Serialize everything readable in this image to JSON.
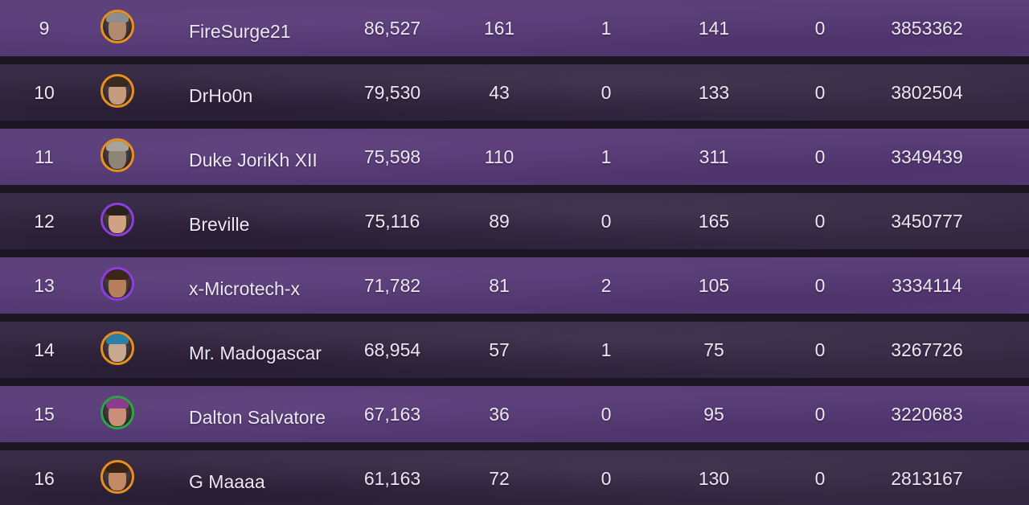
{
  "leaderboard": {
    "rows": [
      {
        "rank": "9",
        "name": "FireSurge21",
        "score": "86,527",
        "stat_a": "161",
        "stat_b": "1",
        "stat_c": "141",
        "stat_d": "0",
        "total": "3853362",
        "avatar_icon": "player-avatar-icon",
        "ring": "#e8901a",
        "skin": "#b38a6e",
        "hair": "#8e8e8e"
      },
      {
        "rank": "10",
        "name": "DrHo0n",
        "score": "79,530",
        "stat_a": "43",
        "stat_b": "0",
        "stat_c": "133",
        "stat_d": "0",
        "total": "3802504",
        "avatar_icon": "player-avatar-icon",
        "ring": "#e8901a",
        "skin": "#c69a7c",
        "hair": "#3a2a20"
      },
      {
        "rank": "11",
        "name": "Duke JoriKh XII",
        "score": "75,598",
        "stat_a": "110",
        "stat_b": "1",
        "stat_c": "311",
        "stat_d": "0",
        "total": "3349439",
        "avatar_icon": "player-avatar-icon",
        "ring": "#e8901a",
        "skin": "#8f8577",
        "hair": "#a8a39a"
      },
      {
        "rank": "12",
        "name": "Breville",
        "score": "75,116",
        "stat_a": "89",
        "stat_b": "0",
        "stat_c": "165",
        "stat_d": "0",
        "total": "3450777",
        "avatar_icon": "player-avatar-icon",
        "ring": "#8a3ee0",
        "skin": "#d0a283",
        "hair": "#2b2220"
      },
      {
        "rank": "13",
        "name": "x-Microtech-x",
        "score": "71,782",
        "stat_a": "81",
        "stat_b": "2",
        "stat_c": "105",
        "stat_d": "0",
        "total": "3334114",
        "avatar_icon": "player-avatar-icon",
        "ring": "#8a3ee0",
        "skin": "#b6805c",
        "hair": "#3b261a"
      },
      {
        "rank": "14",
        "name": "Mr. Madogascar",
        "score": "68,954",
        "stat_a": "57",
        "stat_b": "1",
        "stat_c": "75",
        "stat_d": "0",
        "total": "3267726",
        "avatar_icon": "player-avatar-icon",
        "ring": "#e8901a",
        "skin": "#c8a890",
        "hair": "#2d7fa6"
      },
      {
        "rank": "15",
        "name": "Dalton Salvatore",
        "score": "67,163",
        "stat_a": "36",
        "stat_b": "0",
        "stat_c": "95",
        "stat_d": "0",
        "total": "3220683",
        "avatar_icon": "player-avatar-icon",
        "ring": "#27a844",
        "skin": "#c98f78",
        "hair": "#8b3c8f"
      },
      {
        "rank": "16",
        "name": "G Maaaa",
        "score": "61,163",
        "stat_a": "72",
        "stat_b": "0",
        "stat_c": "130",
        "stat_d": "0",
        "total": "2813167",
        "avatar_icon": "player-avatar-icon",
        "ring": "#e8901a",
        "skin": "#c48a68",
        "hair": "#3a2216"
      }
    ]
  }
}
